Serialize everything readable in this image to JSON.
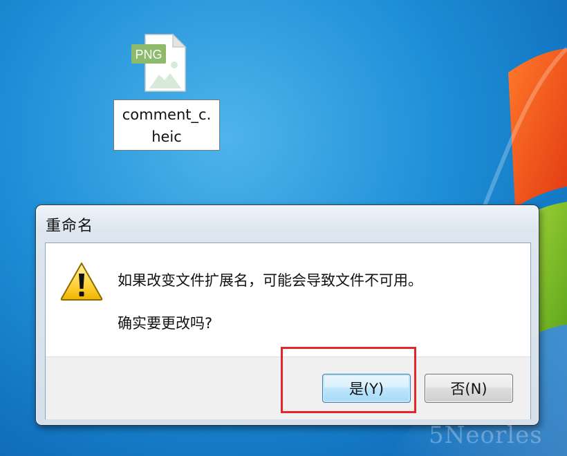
{
  "desktop": {
    "file": {
      "icon_badge": "PNG",
      "name_line1": "comment_c.",
      "name_line2": "heic"
    }
  },
  "dialog": {
    "title": "重命名",
    "message_line1": "如果改变文件扩展名，可能会导致文件不可用。",
    "message_line2": "确实要更改吗?",
    "yes_label": "是(Y)",
    "no_label": "否(N)"
  },
  "watermark": "5Neorles",
  "colors": {
    "desktop_blue": "#1e8fd8",
    "highlight_red": "#e0282b",
    "file_badge_green": "#8dbb6b"
  },
  "icons": {
    "file": "png-file-icon",
    "dialog": "warning-icon"
  }
}
